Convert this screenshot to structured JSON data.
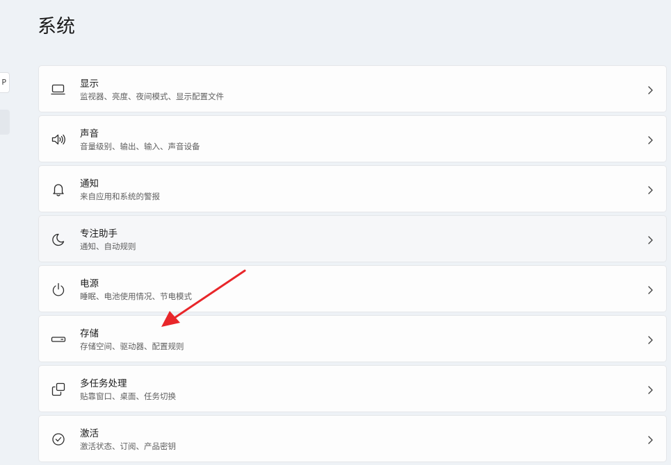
{
  "page": {
    "title": "系统"
  },
  "nav_stub": {
    "partial_glyph": "P"
  },
  "settings": [
    {
      "title": "显示",
      "subtitle": "监视器、亮度、夜间模式、显示配置文件",
      "icon": "monitor-icon"
    },
    {
      "title": "声音",
      "subtitle": "音量级别、输出、输入、声音设备",
      "icon": "speaker-icon"
    },
    {
      "title": "通知",
      "subtitle": "来自应用和系统的警报",
      "icon": "bell-icon"
    },
    {
      "title": "专注助手",
      "subtitle": "通知、自动规则",
      "icon": "moon-icon"
    },
    {
      "title": "电源",
      "subtitle": "睡眠、电池使用情况、节电模式",
      "icon": "power-icon"
    },
    {
      "title": "存储",
      "subtitle": "存储空间、驱动器、配置规则",
      "icon": "storage-drive-icon"
    },
    {
      "title": "多任务处理",
      "subtitle": "贴靠窗口、桌面、任务切换",
      "icon": "multitask-windows-icon"
    },
    {
      "title": "激活",
      "subtitle": "激活状态、订阅、产品密钥",
      "icon": "check-circle-icon"
    }
  ],
  "annotation": {
    "icon": "red-arrow-icon",
    "color": "#e8262a"
  }
}
